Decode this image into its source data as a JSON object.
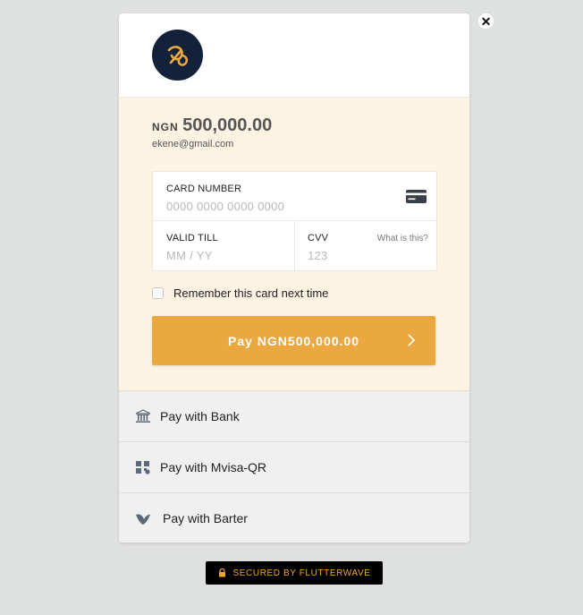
{
  "close": {
    "glyph": "✕"
  },
  "brand": {
    "logo": "butterfly-logo",
    "logo_bg": "#14213a",
    "logo_color": "#eba740"
  },
  "payment": {
    "currency": "NGN",
    "amount": "500,000.00",
    "email": "ekene@gmail.com"
  },
  "card_form": {
    "card_number_label": "CARD NUMBER",
    "card_number_placeholder": "0000 0000 0000 0000",
    "valid_till_label": "VALID TILL",
    "valid_till_placeholder": "MM / YY",
    "cvv_label": "CVV",
    "cvv_placeholder": "123",
    "what_is_this": "What is this?"
  },
  "remember": {
    "label": "Remember this card next time",
    "checked": false
  },
  "pay_button": {
    "label": "Pay NGN500,000.00",
    "color": "#eba740"
  },
  "alternatives": [
    {
      "label": "Pay with Bank",
      "icon": "bank-icon"
    },
    {
      "label": "Pay with Mvisa-QR",
      "icon": "qr-icon"
    },
    {
      "label": "Pay with Barter",
      "icon": "barter-icon"
    }
  ],
  "footer": {
    "secured_label": "SECURED BY FLUTTERWAVE",
    "icon": "lock-icon",
    "accent": "#f5a623"
  }
}
